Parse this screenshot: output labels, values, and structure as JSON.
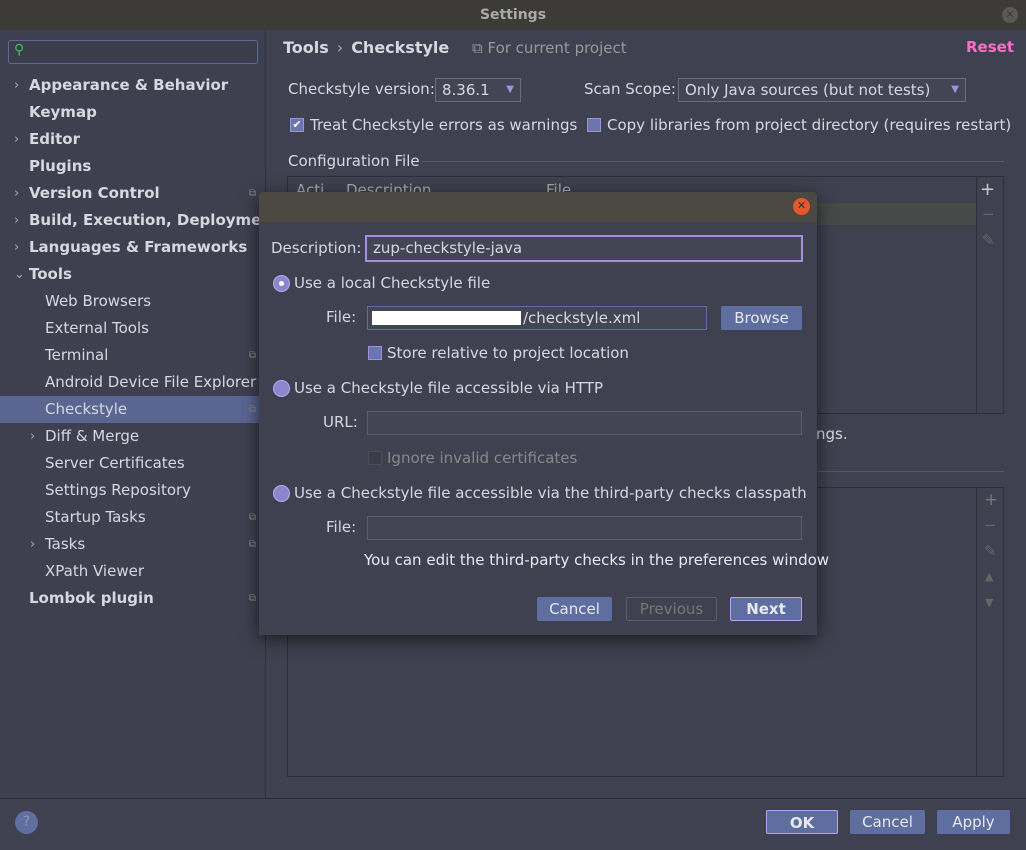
{
  "window": {
    "title": "Settings"
  },
  "sidebar": {
    "items": [
      {
        "label": "Appearance & Behavior",
        "arrow": "›",
        "level": 0
      },
      {
        "label": "Keymap",
        "arrow": "",
        "level": 0
      },
      {
        "label": "Editor",
        "arrow": "›",
        "level": 0
      },
      {
        "label": "Plugins",
        "arrow": "",
        "level": 0
      },
      {
        "label": "Version Control",
        "arrow": "›",
        "level": 0,
        "project": true
      },
      {
        "label": "Build, Execution, Deployment",
        "arrow": "›",
        "level": 0
      },
      {
        "label": "Languages & Frameworks",
        "arrow": "›",
        "level": 0
      },
      {
        "label": "Tools",
        "arrow": "⌄",
        "level": 0
      },
      {
        "label": "Web Browsers",
        "arrow": "",
        "level": 1
      },
      {
        "label": "External Tools",
        "arrow": "",
        "level": 1
      },
      {
        "label": "Terminal",
        "arrow": "",
        "level": 1,
        "project": true
      },
      {
        "label": "Android Device File Explorer",
        "arrow": "",
        "level": 1
      },
      {
        "label": "Checkstyle",
        "arrow": "",
        "level": 1,
        "project": true,
        "selected": true
      },
      {
        "label": "Diff & Merge",
        "arrow": "›",
        "level": 1
      },
      {
        "label": "Server Certificates",
        "arrow": "",
        "level": 1
      },
      {
        "label": "Settings Repository",
        "arrow": "",
        "level": 1
      },
      {
        "label": "Startup Tasks",
        "arrow": "",
        "level": 1,
        "project": true
      },
      {
        "label": "Tasks",
        "arrow": "›",
        "level": 1,
        "project": true
      },
      {
        "label": "XPath Viewer",
        "arrow": "",
        "level": 1
      },
      {
        "label": "Lombok plugin",
        "arrow": "",
        "level": 0,
        "project": true
      }
    ]
  },
  "header": {
    "crumb1": "Tools",
    "sep": "›",
    "crumb2": "Checkstyle",
    "scope_note": "⧉ For current project",
    "reset": "Reset"
  },
  "main": {
    "version_label": "Checkstyle version:",
    "version_value": "8.36.1",
    "scope_label": "Scan Scope:",
    "scope_value": "Only Java sources (but not tests)",
    "treat_warnings": "Treat Checkstyle errors as warnings",
    "treat_checked": true,
    "copy_libs": "Copy libraries from project directory (requires restart)",
    "copy_checked": false,
    "config_title": "Configuration File",
    "columns": [
      "Acti",
      "Description",
      "File"
    ],
    "partial_text": "ngs."
  },
  "dialog": {
    "description_label": "Description:",
    "description_value": "zup-checkstyle-java",
    "opt_local": "Use a local Checkstyle file",
    "file_label": "File:",
    "file_value": "/checkstyle.xml",
    "browse": "Browse",
    "store_relative": "Store relative to project location",
    "opt_http": "Use a Checkstyle file accessible via HTTP",
    "url_label": "URL:",
    "url_value": "",
    "ignore_certs": "Ignore invalid certificates",
    "opt_classpath": "Use a Checkstyle file accessible via the third-party checks classpath",
    "cp_file_label": "File:",
    "cp_file_value": "",
    "hint": "You can edit the third-party checks in the preferences window",
    "cancel": "Cancel",
    "previous": "Previous",
    "next": "Next"
  },
  "footer": {
    "help": "?",
    "ok": "OK",
    "cancel": "Cancel",
    "apply": "Apply"
  },
  "colors": {
    "accent": "#a58ee0",
    "button": "#5e6e9f",
    "selection": "#5a6592",
    "reset": "#ff6ec7"
  }
}
